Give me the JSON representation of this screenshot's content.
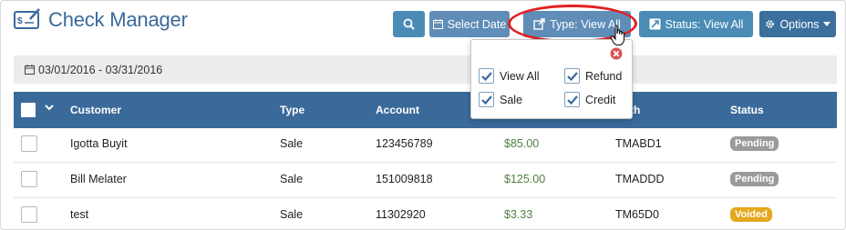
{
  "app": {
    "title": "Check Manager"
  },
  "toolbar": {
    "select_date_label": "Select Date",
    "type_label": "Type: View All",
    "status_label": "Status: View All",
    "options_label": "Options"
  },
  "date_range": "03/01/2016 - 03/31/2016",
  "type_filter_popup": {
    "options": [
      {
        "label": "View All",
        "checked": true
      },
      {
        "label": "Refund",
        "checked": true
      },
      {
        "label": "Sale",
        "checked": true
      },
      {
        "label": "Credit",
        "checked": true
      }
    ]
  },
  "table": {
    "columns": [
      "Customer",
      "Type",
      "Account",
      "",
      "Auth",
      "Status"
    ],
    "rows": [
      {
        "customer": "Igotta Buyit",
        "type": "Sale",
        "account": "123456789",
        "amount": "$85.00",
        "auth": "TMABD1",
        "status": "Pending"
      },
      {
        "customer": "Bill Melater",
        "type": "Sale",
        "account": "151009818",
        "amount": "$125.00",
        "auth": "TMADDD",
        "status": "Pending"
      },
      {
        "customer": "test",
        "type": "Sale",
        "account": "11302920",
        "amount": "$3.33",
        "auth": "TM65D0",
        "status": "Voided"
      }
    ]
  },
  "colors": {
    "brand": "#3a6a9a",
    "button": "#5f8db8",
    "highlight": "#e02020",
    "pending": "#9a9a9a",
    "voided": "#e3a91d",
    "amount": "#4f7f3f"
  }
}
